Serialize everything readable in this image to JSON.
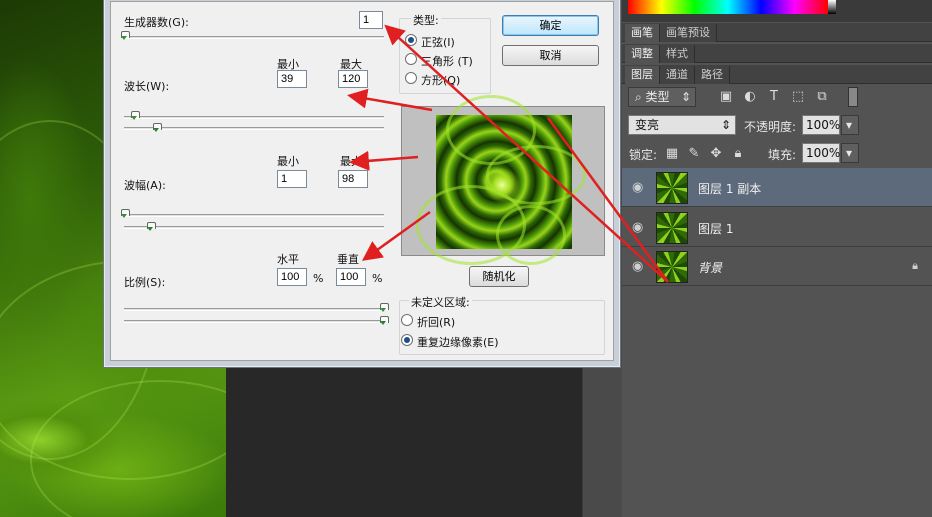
{
  "dialog": {
    "generators_label": "生成器数(G):",
    "generators_value": "1",
    "min_label": "最小",
    "max_label": "最大",
    "wavelength_label": "波长(W):",
    "wavelength_min": "39",
    "wavelength_max": "120",
    "amplitude_label": "波幅(A):",
    "amplitude_min": "1",
    "amplitude_max": "98",
    "horizontal_label": "水平",
    "vertical_label": "垂直",
    "scale_label": "比例(S):",
    "scale_horizontal": "100",
    "scale_vertical": "100",
    "percent": "%",
    "type_group": {
      "title": "类型:",
      "options": [
        "正弦(I)",
        "三角形 (T)",
        "方形(Q)"
      ],
      "selected": "正弦(I)"
    },
    "ok_label": "确定",
    "cancel_label": "取消",
    "randomize_label": "随机化",
    "undefined_group": {
      "title": "未定义区域:",
      "options": [
        "折回(R)",
        "重复边缘像素(E)"
      ],
      "selected": "重复边缘像素(E)"
    }
  },
  "panels": {
    "tabs_top": [
      "画笔",
      "画笔预设"
    ],
    "tabs_mid": [
      "调整",
      "样式"
    ],
    "tabs_layers": [
      "图层",
      "通道",
      "路径"
    ],
    "filter_kind": "类型",
    "blend_mode": "变亮",
    "opacity_label": "不透明度:",
    "opacity_value": "100%",
    "lock_label": "锁定:",
    "fill_label": "填充:",
    "fill_value": "100%",
    "layers": [
      {
        "name": "图层 1 副本",
        "selected": true,
        "locked": false
      },
      {
        "name": "图层 1",
        "selected": false,
        "locked": false
      },
      {
        "name": "背景",
        "selected": false,
        "locked": true
      }
    ]
  },
  "colors": {
    "annotation_arrow": "#e02020",
    "selected_layer": "#5d6a7c",
    "panel_bg": "#535353"
  }
}
